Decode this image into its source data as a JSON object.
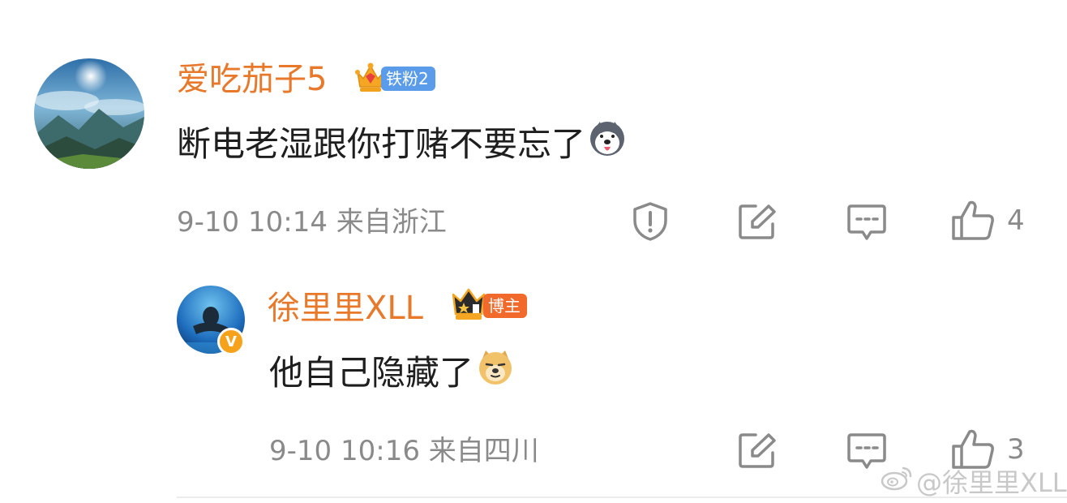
{
  "comment": {
    "username": "爱吃茄子5",
    "fan_badge": "铁粉2",
    "text": "断电老湿跟你打赌不要忘了",
    "emoji": "husky-emoji",
    "meta": "9-10 10:14 来自浙江",
    "like_count": "4",
    "icons": [
      "report-icon",
      "share-icon",
      "comment-icon",
      "like-icon"
    ]
  },
  "reply": {
    "username": "徐里里XLL",
    "role_badge": "博主",
    "verified_mark": "V",
    "text": "他自己隐藏了",
    "emoji": "doge-emoji",
    "meta": "9-10 10:16 来自四川",
    "like_count": "3",
    "icons": [
      "share-icon",
      "comment-icon",
      "like-icon"
    ]
  },
  "watermark": "@徐里里XLL",
  "colors": {
    "username": "#e8782a",
    "fan_badge": "#5a9bea",
    "role_badge": "#f26a2b",
    "meta": "#8a8a8a"
  }
}
